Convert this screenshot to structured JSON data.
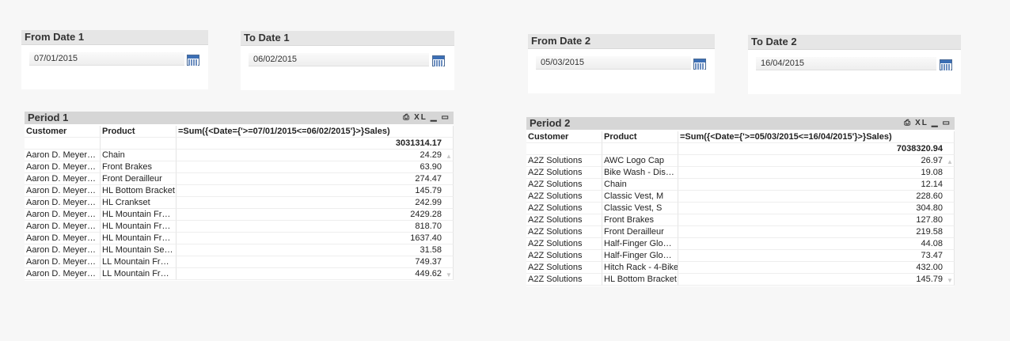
{
  "date_boxes": [
    {
      "label": "From Date 1",
      "value": "07/01/2015"
    },
    {
      "label": "To Date 1",
      "value": "06/02/2015"
    },
    {
      "label": "From Date 2",
      "value": "05/03/2015"
    },
    {
      "label": "To Date 2",
      "value": "16/04/2015"
    }
  ],
  "tables": [
    {
      "title": "Period 1",
      "controls": [
        "⎙",
        "XL",
        "▁",
        "▭"
      ],
      "headers": [
        "Customer",
        "Product",
        "=Sum({<Date={'>=07/01/2015<=06/02/2015'}>}Sales)"
      ],
      "total": "3031314.17",
      "rows": [
        [
          "Aaron D. Meyer…",
          "Chain",
          "24.29"
        ],
        [
          "Aaron D. Meyer…",
          "Front Brakes",
          "63.90"
        ],
        [
          "Aaron D. Meyer…",
          "Front Derailleur",
          "274.47"
        ],
        [
          "Aaron D. Meyer…",
          "HL Bottom Bracket",
          "145.79"
        ],
        [
          "Aaron D. Meyer…",
          "HL Crankset",
          "242.99"
        ],
        [
          "Aaron D. Meyer…",
          "HL Mountain Fr…",
          "2429.28"
        ],
        [
          "Aaron D. Meyer…",
          "HL Mountain Fr…",
          "818.70"
        ],
        [
          "Aaron D. Meyer…",
          "HL Mountain Fr…",
          "1637.40"
        ],
        [
          "Aaron D. Meyer…",
          "HL Mountain Se…",
          "31.58"
        ],
        [
          "Aaron D. Meyer…",
          "LL Mountain Fr…",
          "749.37"
        ],
        [
          "Aaron D. Meyer…",
          "LL Mountain Fr…",
          "449.62"
        ]
      ]
    },
    {
      "title": "Period 2",
      "controls": [
        "⎙",
        "XL",
        "▁",
        "▭"
      ],
      "headers": [
        "Customer",
        "Product",
        "=Sum({<Date={'>=05/03/2015<=16/04/2015'}>}Sales)"
      ],
      "total": "7038320.94",
      "rows": [
        [
          "A2Z Solutions",
          "AWC Logo Cap",
          "26.97"
        ],
        [
          "A2Z Solutions",
          "Bike Wash - Dis…",
          "19.08"
        ],
        [
          "A2Z Solutions",
          "Chain",
          "12.14"
        ],
        [
          "A2Z Solutions",
          "Classic Vest, M",
          "228.60"
        ],
        [
          "A2Z Solutions",
          "Classic Vest, S",
          "304.80"
        ],
        [
          "A2Z Solutions",
          "Front Brakes",
          "127.80"
        ],
        [
          "A2Z Solutions",
          "Front Derailleur",
          "219.58"
        ],
        [
          "A2Z Solutions",
          "Half-Finger Glo…",
          "44.08"
        ],
        [
          "A2Z Solutions",
          "Half-Finger Glo…",
          "73.47"
        ],
        [
          "A2Z Solutions",
          "Hitch Rack - 4-Bike",
          "432.00"
        ],
        [
          "A2Z Solutions",
          "HL Bottom Bracket",
          "145.79"
        ]
      ]
    }
  ]
}
